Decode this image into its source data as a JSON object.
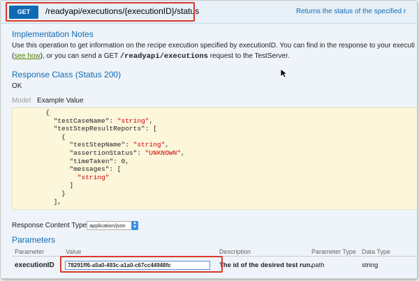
{
  "endpoint": {
    "method": "GET",
    "path": "/readyapi/executions/{executionID}/status",
    "summary": "Returns the status of the specified r"
  },
  "implementation": {
    "title": "Implementation Notes",
    "line1": "Use this operation to get information on the recipe execution specified by executionID. You can find in the response to your executi",
    "line2_prefix": "(",
    "see_how": "see how",
    "line2_mid": "), or you can send a GET ",
    "line2_code": "/readyapi/executions",
    "line2_suffix": " request to the TestServer."
  },
  "response_class": {
    "title": "Response Class (Status 200)",
    "status": "OK"
  },
  "model_tabs": {
    "model": "Model",
    "example": "Example Value"
  },
  "example_code": [
    {
      "indent": 6,
      "text": "{",
      "type": "k"
    },
    {
      "indent": 8,
      "key": "\"testCaseName\"",
      "value": "\"string\"",
      "tail": ","
    },
    {
      "indent": 8,
      "key": "\"testStepResultReports\"",
      "tail": ": ["
    },
    {
      "indent": 10,
      "text": "{",
      "type": "k"
    },
    {
      "indent": 12,
      "key": "\"testStepName\"",
      "value": "\"string\"",
      "tail": ","
    },
    {
      "indent": 12,
      "key": "\"assertionStatus\"",
      "value": "\"UNKNOWN\"",
      "tail": ","
    },
    {
      "indent": 12,
      "key": "\"timeTaken\"",
      "value": "0",
      "tail": ","
    },
    {
      "indent": 12,
      "key": "\"messages\"",
      "tail": ": ["
    },
    {
      "indent": 14,
      "value": "\"string\"",
      "text": ""
    },
    {
      "indent": 12,
      "text": "]",
      "type": "k"
    },
    {
      "indent": 10,
      "text": "}",
      "type": "k"
    },
    {
      "indent": 8,
      "text": "],",
      "type": "k"
    }
  ],
  "response_content_type": {
    "label": "Response Content Type",
    "selected": "application/json"
  },
  "parameters": {
    "title": "Parameters",
    "headers": [
      "Parameter",
      "Value",
      "Description",
      "Parameter Type",
      "Data Type"
    ],
    "rows": [
      {
        "name": "executionID",
        "value": "78291ff6-a5a0-493c-a1a0-c67cc44948fc",
        "description": "The id of the desired test run.",
        "param_type": "path",
        "data_type": "string"
      }
    ]
  },
  "colors": {
    "get_button": "#0f6ab4",
    "highlight": "#d9392b",
    "heading": "#0f6ab4",
    "code_bg": "#fcf6db",
    "string_value": "#c80000"
  }
}
